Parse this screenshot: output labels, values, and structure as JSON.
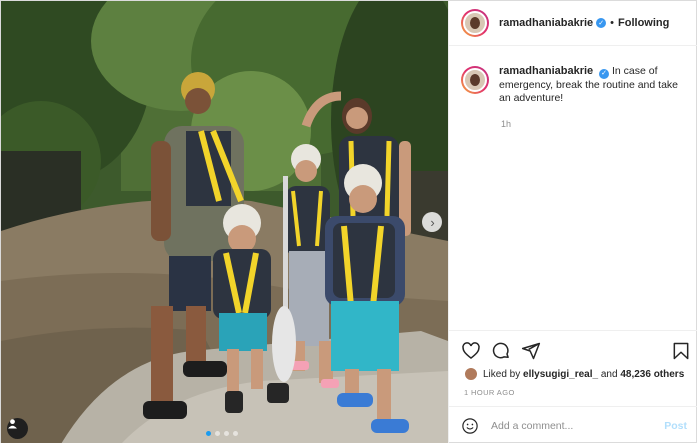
{
  "post": {
    "username": "ramadhaniabakrie",
    "separator": "•",
    "follow_label": "Following",
    "verified": true
  },
  "caption": {
    "username": "ramadhaniabakrie",
    "text": "In case of emergency, break the routine and take an adventure!",
    "time": "1h"
  },
  "actions": {
    "like_icon": "heart-icon",
    "comment_icon": "comment-icon",
    "share_icon": "send-icon",
    "save_icon": "bookmark-icon"
  },
  "likes": {
    "prefix": "Liked by",
    "user": "ellysugigi_real_",
    "middle": "and",
    "count": "48,236 others"
  },
  "timestamp": "1 HOUR AGO",
  "comment_box": {
    "placeholder": "Add a comment...",
    "post_label": "Post"
  },
  "carousel": {
    "slides": 4,
    "current": 1
  },
  "colors": {
    "verified": "#3897f0",
    "active_dot": "#1a9bf0",
    "post_disabled": "#b2dffc"
  }
}
